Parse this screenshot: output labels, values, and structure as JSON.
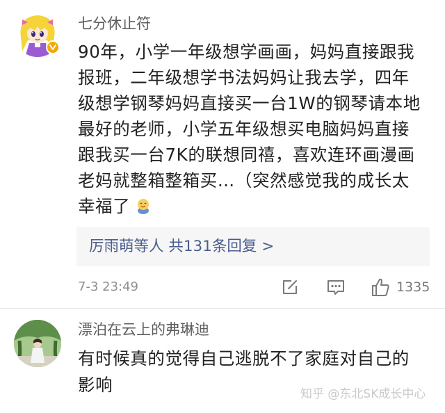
{
  "comments": [
    {
      "username": "七分休止符",
      "lines": [
        "90年，小学一年级想学画画，妈妈直接跟我",
        "报班，二年级想学书法妈妈让我去学，四年",
        "级想学钢琴妈妈直接买一台1W的钢琴请本地",
        "最好的老师，小学五年级想买电脑妈妈直接",
        "跟我买一台7K的联想同禧，喜欢连环画漫画",
        "老妈就整箱整箱买…（突然感觉我的成长太",
        "幸福了"
      ],
      "emoji_icon": "smiling-baby-emoji",
      "replies": {
        "names": "厉雨萌等人",
        "count_text": "共131条回复",
        "arrow": ">"
      },
      "timestamp": "7-3 23:49",
      "like_count": "1335"
    },
    {
      "username": "漂泊在云上的弗琳迪",
      "lines": [
        "有时候真的觉得自己逃脱不了家庭对自己的",
        "影响"
      ]
    }
  ],
  "watermark": "知乎 @东北SK成长中心",
  "colors": {
    "link": "#4a5c8c",
    "text": "#222222",
    "meta": "#8f8f8f",
    "reply_bg": "#f6f6f6",
    "vip_badge": "#f2a900"
  }
}
